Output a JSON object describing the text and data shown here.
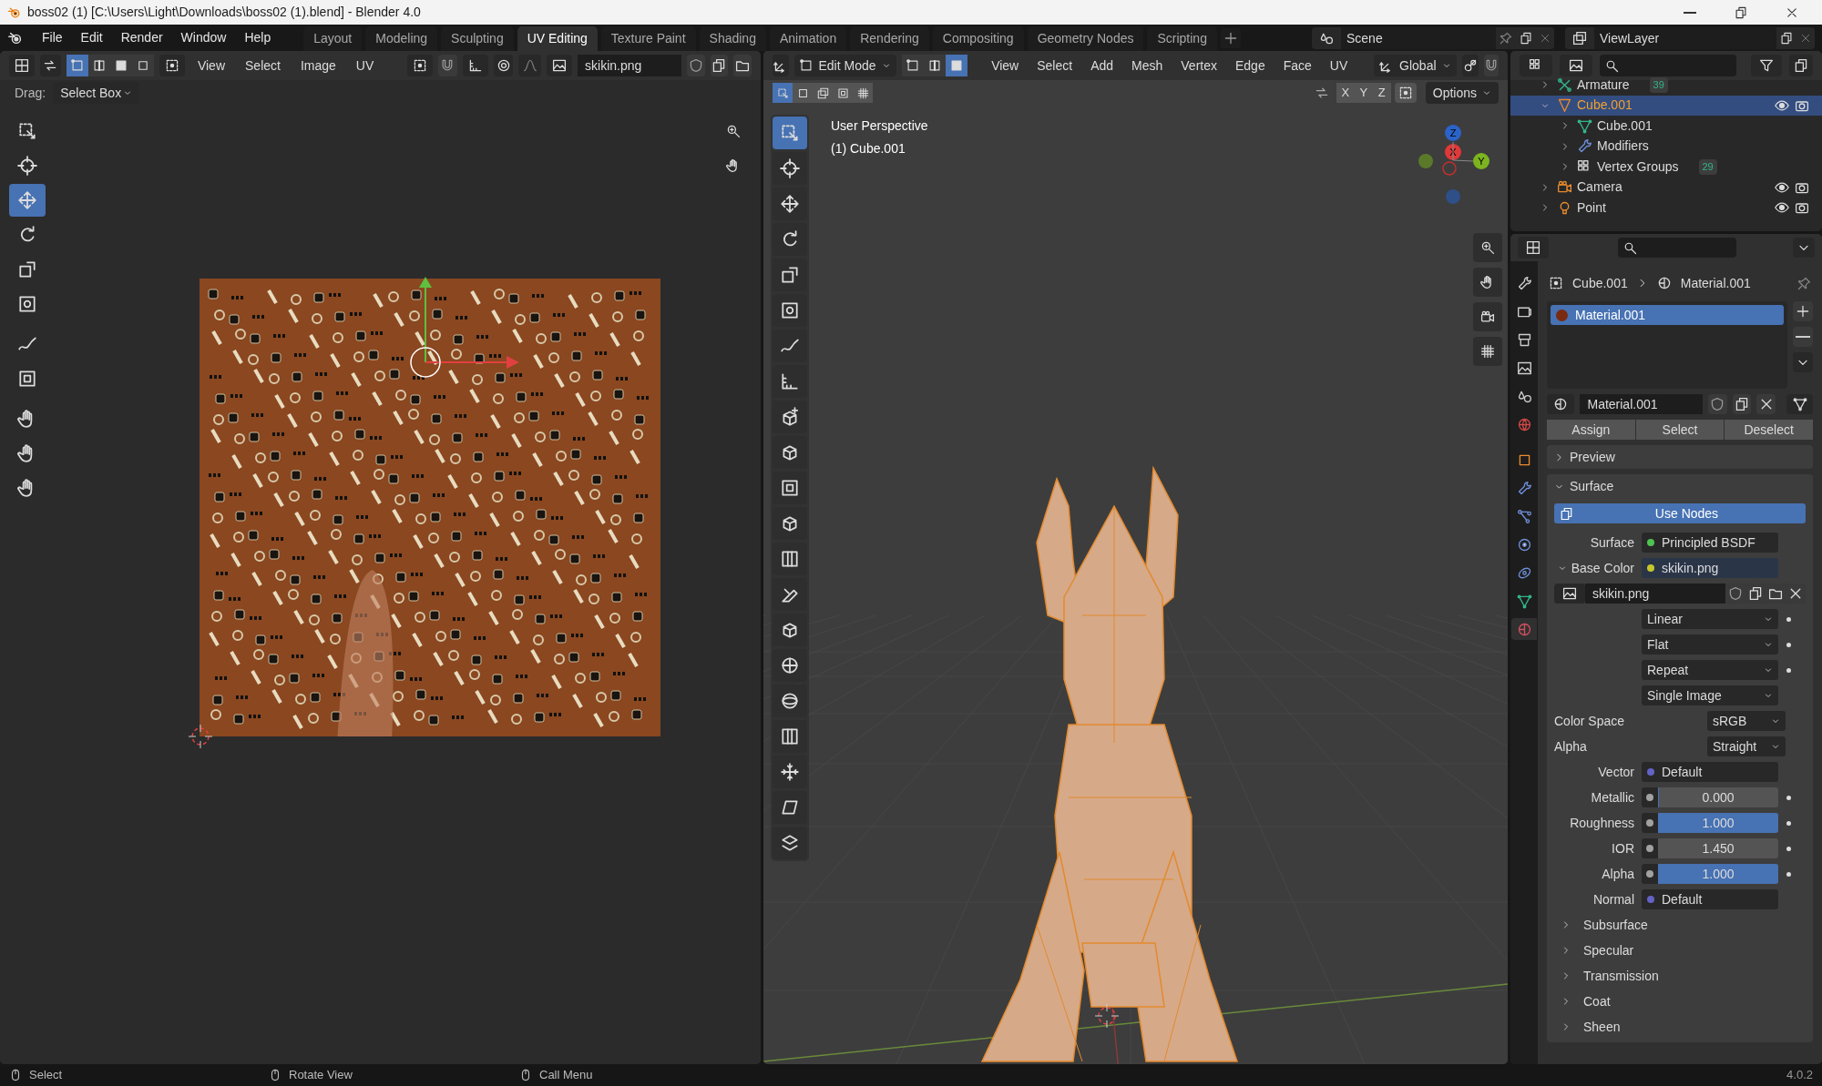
{
  "window": {
    "title": "boss02 (1) [C:\\Users\\Light\\Downloads\\boss02 (1).blend] - Blender 4.0"
  },
  "menu": [
    "File",
    "Edit",
    "Render",
    "Window",
    "Help"
  ],
  "workspaces": [
    {
      "label": "Layout",
      "selected": false
    },
    {
      "label": "Modeling",
      "selected": false
    },
    {
      "label": "Sculpting",
      "selected": false
    },
    {
      "label": "UV Editing",
      "selected": true
    },
    {
      "label": "Texture Paint",
      "selected": false
    },
    {
      "label": "Shading",
      "selected": false
    },
    {
      "label": "Animation",
      "selected": false
    },
    {
      "label": "Rendering",
      "selected": false
    },
    {
      "label": "Compositing",
      "selected": false
    },
    {
      "label": "Geometry Nodes",
      "selected": false
    },
    {
      "label": "Scripting",
      "selected": false
    }
  ],
  "scene": "Scene",
  "view_layer": "ViewLayer",
  "uv_editor": {
    "select_modes": [
      {
        "selected": true
      },
      {
        "selected": false
      },
      {
        "selected": false
      },
      {
        "selected": false
      }
    ],
    "menus": [
      "View",
      "Select",
      "Image",
      "UV"
    ],
    "image": "skikin.png",
    "drag_label": "Drag:",
    "drag_value": "Select Box",
    "tools": [
      {
        "selected": false
      },
      {
        "selected": false
      },
      {
        "selected": true
      },
      {
        "selected": false
      },
      {
        "selected": false
      },
      {
        "selected": false
      },
      {
        "selected": false
      },
      {
        "selected": false
      },
      {
        "selected": false
      },
      {
        "selected": false
      },
      {
        "selected": false
      }
    ]
  },
  "viewport": {
    "mode": "Edit Mode",
    "select_modes": [
      {
        "selected": false
      },
      {
        "selected": false
      },
      {
        "selected": true
      }
    ],
    "menus": [
      "View",
      "Select",
      "Add",
      "Mesh",
      "Vertex",
      "Edge",
      "Face",
      "UV"
    ],
    "orientation": "Global",
    "axes": [
      "X",
      "Y",
      "Z"
    ],
    "options": "Options",
    "overlay_text": [
      "User Perspective",
      "(1) Cube.001"
    ],
    "gizmo_axes": [
      "Z",
      "X",
      "Y"
    ],
    "tools": [
      {
        "selected": true
      },
      {
        "selected": false
      },
      {
        "selected": false
      },
      {
        "selected": false
      },
      {
        "selected": false
      },
      {
        "selected": false
      },
      {
        "selected": false
      },
      {
        "selected": false
      },
      {
        "selected": false
      },
      {
        "selected": false
      },
      {
        "selected": false
      },
      {
        "selected": false
      },
      {
        "selected": false
      },
      {
        "selected": false
      },
      {
        "selected": false
      },
      {
        "selected": false
      },
      {
        "selected": false
      },
      {
        "selected": false
      },
      {
        "selected": false
      },
      {
        "selected": false
      },
      {
        "selected": false
      }
    ]
  },
  "outliner": {
    "items": [
      {
        "label": "Armature",
        "kind": "armature",
        "expanded": false,
        "selected": false,
        "badge": "39"
      },
      {
        "label": "Cube.001",
        "kind": "object",
        "expanded": true,
        "selected": true,
        "visible": true,
        "children": [
          {
            "label": "Cube.001",
            "kind": "mesh",
            "expanded": false,
            "selected": false
          },
          {
            "label": "Modifiers",
            "kind": "modifiers",
            "expanded": false,
            "selected": false
          },
          {
            "label": "Vertex Groups",
            "kind": "vertex_groups",
            "expanded": false,
            "selected": false,
            "badge": "29"
          }
        ]
      },
      {
        "label": "Camera",
        "kind": "camera",
        "expanded": false,
        "selected": false,
        "visible": true
      },
      {
        "label": "Point",
        "kind": "light",
        "expanded": false,
        "selected": false,
        "visible": true
      }
    ]
  },
  "properties": {
    "tabs": [
      {
        "selected": false
      },
      {
        "selected": false
      },
      {
        "selected": false
      },
      {
        "selected": false
      },
      {
        "selected": false
      },
      {
        "selected": false
      },
      {
        "selected": false
      },
      {
        "selected": false
      },
      {
        "selected": false
      },
      {
        "selected": false
      },
      {
        "selected": false
      },
      {
        "selected": false
      },
      {
        "selected": true
      }
    ],
    "breadcrumb": [
      "Cube.001",
      "Material.001"
    ],
    "slots": [
      {
        "label": "Material.001",
        "selected": true
      }
    ],
    "material": "Material.001",
    "buttons": [
      "Assign",
      "Select",
      "Deselect"
    ],
    "preview": {
      "label": "Preview",
      "expanded": false
    },
    "surface": {
      "label": "Surface",
      "expanded": true
    },
    "use_nodes": "Use Nodes",
    "rows": [
      {
        "kind": "socket",
        "label": "Surface",
        "value": "Principled BSDF",
        "color": "#4fc34f"
      },
      {
        "kind": "socket",
        "label": "Base Color",
        "value": "skikin.png",
        "color": "#c7c729",
        "expanded": true
      },
      {
        "kind": "image",
        "value": "skikin.png"
      },
      {
        "kind": "dropdown",
        "value": "Linear",
        "keyframe": true
      },
      {
        "kind": "dropdown",
        "value": "Flat",
        "keyframe": true
      },
      {
        "kind": "dropdown",
        "value": "Repeat",
        "keyframe": true
      },
      {
        "kind": "dropdown",
        "value": "Single Image",
        "keyframe": false
      },
      {
        "kind": "select",
        "label": "Color Space",
        "value": "sRGB"
      },
      {
        "kind": "select",
        "label": "Alpha",
        "value": "Straight"
      },
      {
        "kind": "socket",
        "label": "Vector",
        "value": "Default",
        "color": "#6363c7"
      },
      {
        "kind": "slider",
        "label": "Metallic",
        "value": "0.000",
        "level": 0
      },
      {
        "kind": "slider",
        "label": "Roughness",
        "value": "1.000",
        "level": 1
      },
      {
        "kind": "number",
        "label": "IOR",
        "value": "1.450"
      },
      {
        "kind": "slider",
        "label": "Alpha",
        "value": "1.000",
        "level": 1
      },
      {
        "kind": "socket",
        "label": "Normal",
        "value": "Default",
        "color": "#6363c7"
      },
      {
        "kind": "subpanel",
        "label": "Subsurface",
        "expanded": false
      },
      {
        "kind": "subpanel",
        "label": "Specular",
        "expanded": false
      },
      {
        "kind": "subpanel",
        "label": "Transmission",
        "expanded": false
      },
      {
        "kind": "subpanel",
        "label": "Coat",
        "expanded": false
      },
      {
        "kind": "subpanel",
        "label": "Sheen",
        "expanded": false
      }
    ]
  },
  "status_bar": {
    "hints": [
      "Select",
      "Rotate View",
      "Call Menu"
    ],
    "version": "4.0.2"
  }
}
